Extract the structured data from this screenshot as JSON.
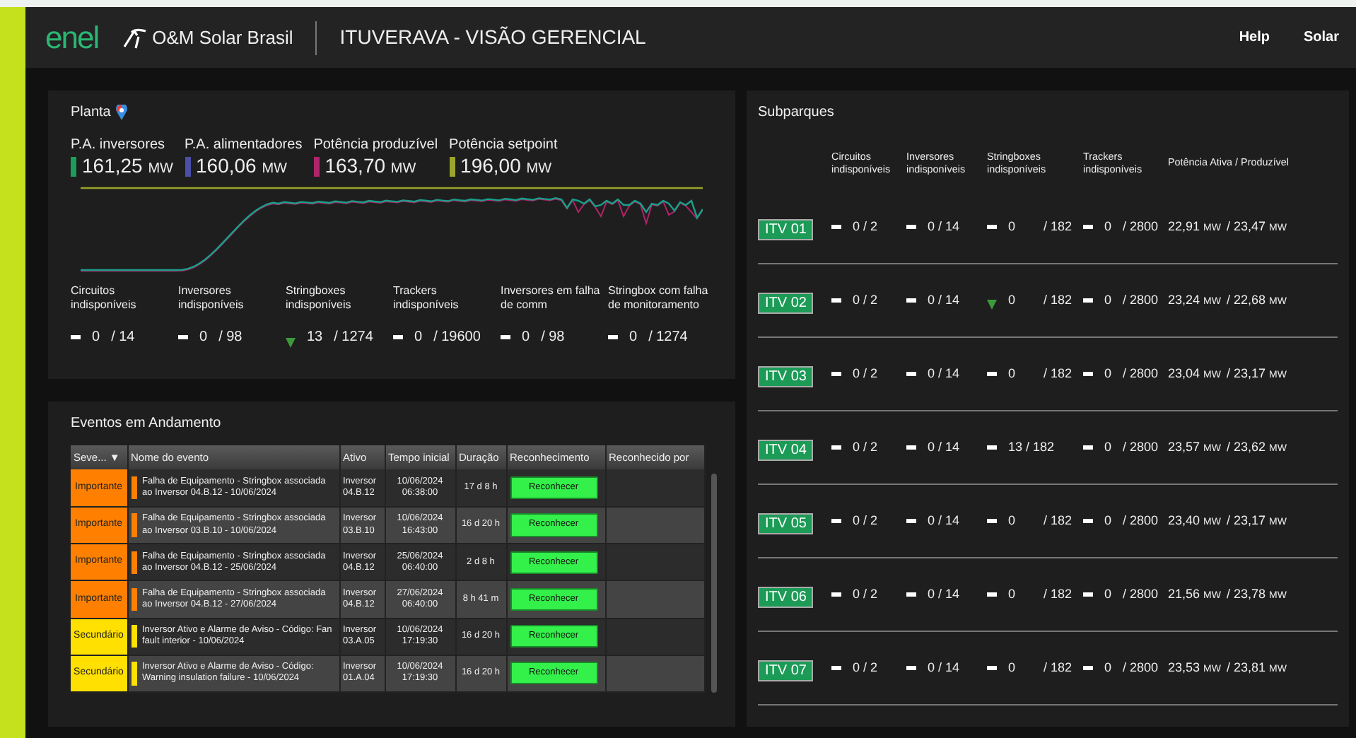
{
  "header": {
    "logo": "enel",
    "brand": "O&M Solar Brasil",
    "title": "ITUVERAVA - VISÃO GERENCIAL",
    "links": [
      "Help",
      "Solar"
    ]
  },
  "plant": {
    "title": "Planta",
    "metrics": [
      {
        "label": "P.A. inversores",
        "value": "161,25",
        "unit": "MW",
        "color": "#1a9e5a"
      },
      {
        "label": "P.A. alimentadores",
        "value": "160,06",
        "unit": "MW",
        "color": "#4b4fa8"
      },
      {
        "label": "Potência produzível",
        "value": "163,70",
        "unit": "MW",
        "color": "#b0246a"
      },
      {
        "label": "Potência setpoint",
        "value": "196,00",
        "unit": "MW",
        "color": "#9aa52a"
      }
    ],
    "stats": [
      {
        "label": "Circuitos indisponíveis",
        "decreasing": false,
        "value": "0",
        "total": "/ 14"
      },
      {
        "label": "Inversores indisponíveis",
        "decreasing": false,
        "value": "0",
        "total": "/ 98"
      },
      {
        "label": "Stringboxes indisponíveis",
        "decreasing": true,
        "value": "13",
        "total": "/ 1274"
      },
      {
        "label": "Trackers indisponíveis",
        "decreasing": false,
        "value": "0",
        "total": "/ 19600"
      },
      {
        "label": "Inversores em falha de comm",
        "decreasing": false,
        "value": "0",
        "total": "/ 98"
      },
      {
        "label": "Stringbox com falha de monitoramento",
        "decreasing": false,
        "value": "0",
        "total": "/ 1274"
      }
    ]
  },
  "events": {
    "title": "Eventos em Andamento",
    "columns": [
      "Seve... ▼",
      "Nome do evento",
      "Ativo",
      "Tempo inicial",
      "Duração",
      "Reconhecimento",
      "Reconhecido por"
    ],
    "rows": [
      {
        "severity": "Importante",
        "color": "#ff8000",
        "name": "Falha de Equipamento - Stringbox associada ao Inversor 04.B.12 - 10/06/2024",
        "asset": "Inversor 04.B.12",
        "start": "10/06/2024 06:38:00",
        "duration": "17 d 8 h",
        "action": "Reconhecer"
      },
      {
        "severity": "Importante",
        "color": "#ff8000",
        "name": "Falha de Equipamento - Stringbox associada ao Inversor 03.B.10 - 10/06/2024",
        "asset": "Inversor 03.B.10",
        "start": "10/06/2024 16:43:00",
        "duration": "16 d 20 h",
        "action": "Reconhecer"
      },
      {
        "severity": "Importante",
        "color": "#ff8000",
        "name": "Falha de Equipamento - Stringbox associada ao Inversor 04.B.12 - 25/06/2024",
        "asset": "Inversor 04.B.12",
        "start": "25/06/2024 06:40:00",
        "duration": "2 d 8 h",
        "action": "Reconhecer"
      },
      {
        "severity": "Importante",
        "color": "#ff8000",
        "name": "Falha de Equipamento - Stringbox associada ao Inversor 04.B.12 - 27/06/2024",
        "asset": "Inversor 04.B.12",
        "start": "27/06/2024 06:40:00",
        "duration": "8 h 41 m",
        "action": "Reconhecer"
      },
      {
        "severity": "Secundário",
        "color": "#ffe000",
        "name": "Inversor Ativo e Alarme de Aviso - Código: Fan fault interior - 10/06/2024",
        "asset": "Inversor 03.A.05",
        "start": "10/06/2024 17:19:30",
        "duration": "16 d 20 h",
        "action": "Reconhecer"
      },
      {
        "severity": "Secundário",
        "color": "#ffe000",
        "name": "Inversor Ativo e Alarme de Aviso - Código: Warning insulation failure - 10/06/2024",
        "asset": "Inversor 01.A.04",
        "start": "10/06/2024 17:19:30",
        "duration": "16 d 20 h",
        "action": "Reconhecer"
      }
    ]
  },
  "subparks": {
    "title": "Subparques",
    "columns": [
      "Circuitos indisponíveis",
      "Inversores indisponíveis",
      "Stringboxes indisponíveis",
      "Trackers indisponíveis",
      "Potência Ativa / Produzível"
    ],
    "rows": [
      {
        "name": "ITV 01",
        "cells": [
          {
            "decreasing": false,
            "value": "0 / 2"
          },
          {
            "decreasing": false,
            "value": "0 / 14"
          },
          {
            "decreasing": false,
            "value": "0",
            "total": "/ 182"
          },
          {
            "decreasing": false,
            "value": "0",
            "total": "/ 2800"
          }
        ],
        "active": "22,91",
        "active_unit": "MW",
        "produced": "/ 23,47",
        "produced_unit": "MW"
      },
      {
        "name": "ITV 02",
        "cells": [
          {
            "decreasing": false,
            "value": "0 / 2"
          },
          {
            "decreasing": false,
            "value": "0 / 14"
          },
          {
            "decreasing": true,
            "value": "0",
            "total": "/ 182"
          },
          {
            "decreasing": false,
            "value": "0",
            "total": "/ 2800"
          }
        ],
        "active": "23,24",
        "active_unit": "MW",
        "produced": "/ 22,68",
        "produced_unit": "MW"
      },
      {
        "name": "ITV 03",
        "cells": [
          {
            "decreasing": false,
            "value": "0 / 2"
          },
          {
            "decreasing": false,
            "value": "0 / 14"
          },
          {
            "decreasing": false,
            "value": "0",
            "total": "/ 182"
          },
          {
            "decreasing": false,
            "value": "0",
            "total": "/ 2800"
          }
        ],
        "active": "23,04",
        "active_unit": "MW",
        "produced": "/ 23,17",
        "produced_unit": "MW"
      },
      {
        "name": "ITV 04",
        "cells": [
          {
            "decreasing": false,
            "value": "0 / 2"
          },
          {
            "decreasing": false,
            "value": "0 / 14"
          },
          {
            "decreasing": false,
            "value": "13 / 182"
          },
          {
            "decreasing": false,
            "value": "0",
            "total": "/ 2800"
          }
        ],
        "active": "23,57",
        "active_unit": "MW",
        "produced": "/ 23,62",
        "produced_unit": "MW"
      },
      {
        "name": "ITV 05",
        "cells": [
          {
            "decreasing": false,
            "value": "0 / 2"
          },
          {
            "decreasing": false,
            "value": "0 / 14"
          },
          {
            "decreasing": false,
            "value": "0",
            "total": "/ 182"
          },
          {
            "decreasing": false,
            "value": "0",
            "total": "/ 2800"
          }
        ],
        "active": "23,40",
        "active_unit": "MW",
        "produced": "/ 23,17",
        "produced_unit": "MW"
      },
      {
        "name": "ITV 06",
        "cells": [
          {
            "decreasing": false,
            "value": "0 / 2"
          },
          {
            "decreasing": false,
            "value": "0 / 14"
          },
          {
            "decreasing": false,
            "value": "0",
            "total": "/ 182"
          },
          {
            "decreasing": false,
            "value": "0",
            "total": "/ 2800"
          }
        ],
        "active": "21,56",
        "active_unit": "MW",
        "produced": "/ 23,78",
        "produced_unit": "MW"
      },
      {
        "name": "ITV 07",
        "cells": [
          {
            "decreasing": false,
            "value": "0 / 2"
          },
          {
            "decreasing": false,
            "value": "0 / 14"
          },
          {
            "decreasing": false,
            "value": "0",
            "total": "/ 182"
          },
          {
            "decreasing": false,
            "value": "0",
            "total": "/ 2800"
          }
        ],
        "active": "23,53",
        "active_unit": "MW",
        "produced": "/ 23,81",
        "produced_unit": "MW"
      }
    ]
  }
}
